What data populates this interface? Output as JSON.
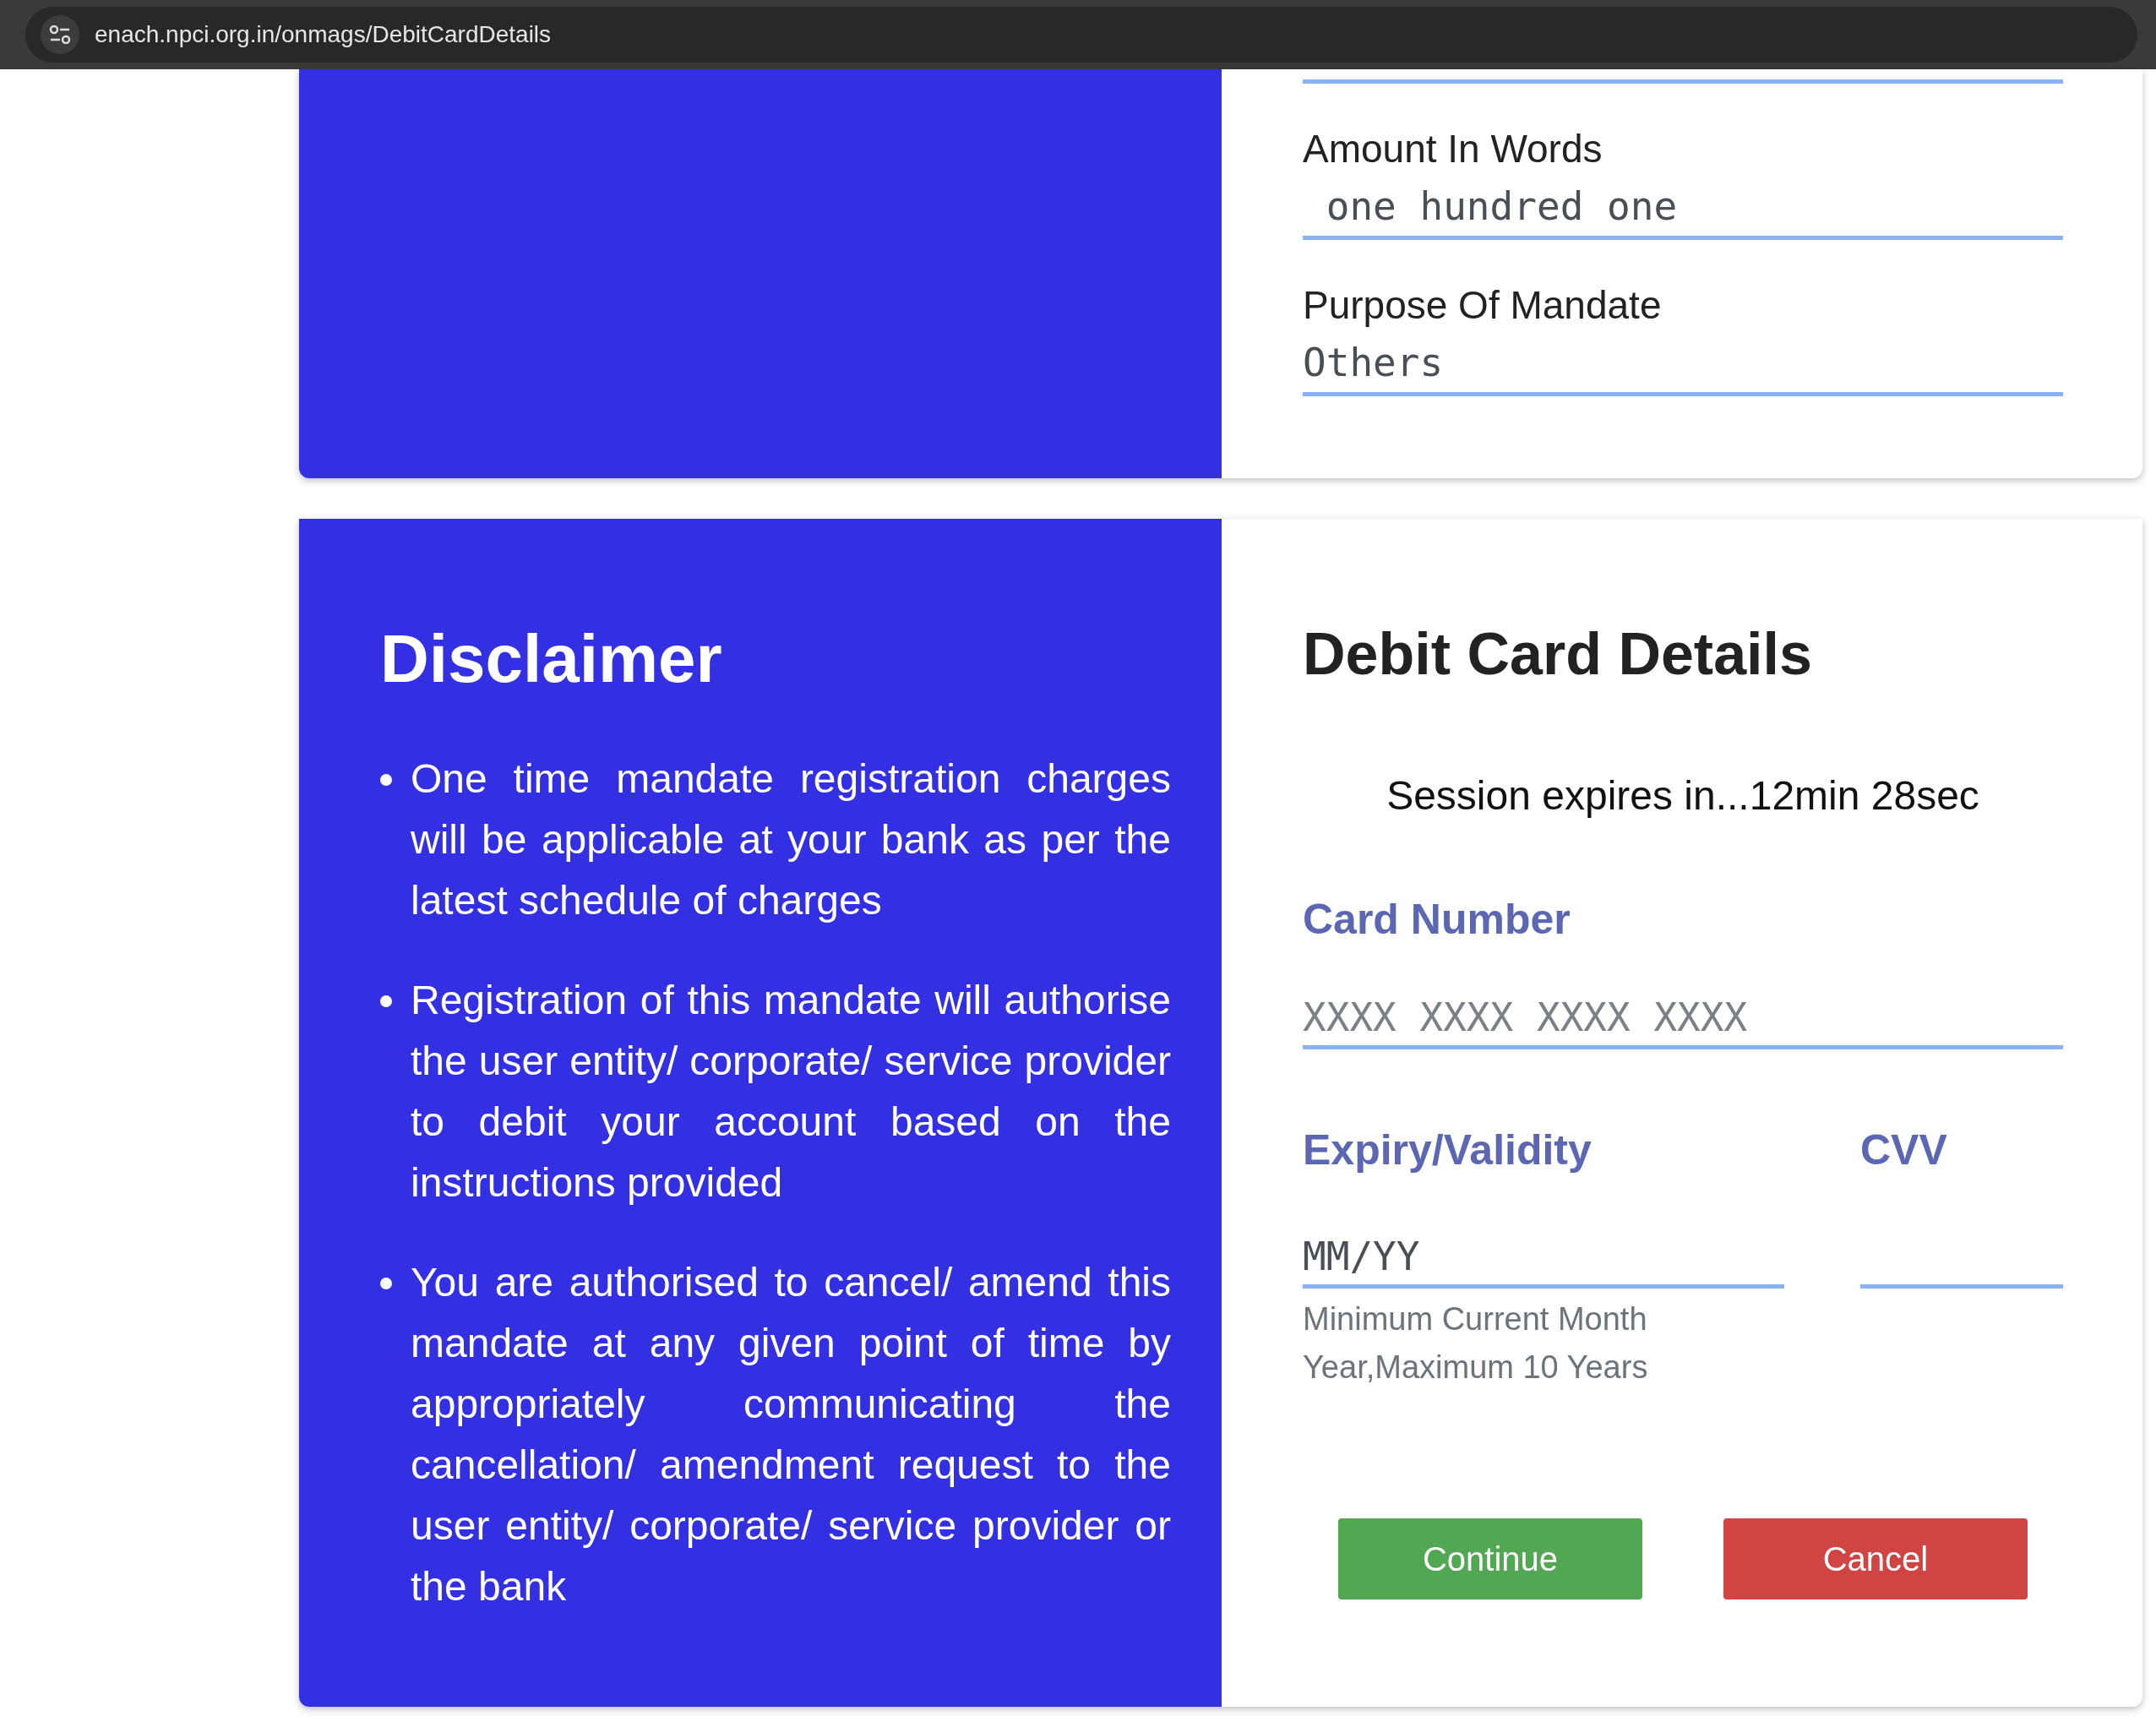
{
  "browser": {
    "url": "enach.npci.org.in/onmags/DebitCardDetails"
  },
  "mandate_card": {
    "fields": [
      {
        "label": "Amount In Words",
        "value": " one hundred one"
      },
      {
        "label": "Purpose Of Mandate",
        "value": "Others"
      }
    ]
  },
  "disclaimer": {
    "title": "Disclaimer",
    "items": [
      "One time mandate registration charges will be applicable at your bank as per the latest schedule of charges",
      "Registration of this mandate will authorise the user entity/ corporate/ service provider to debit your account based on the instructions provided",
      "You are authorised to cancel/ amend this mandate at any given point of time by appropriately communicating the cancellation/ amendment request to the user entity/ corporate/ service provider or the bank"
    ]
  },
  "debit_card": {
    "title": "Debit Card Details",
    "session": "Session expires in...12min 28sec",
    "card_number": {
      "label": "Card Number",
      "placeholder": "XXXX XXXX XXXX XXXX"
    },
    "expiry": {
      "label": "Expiry/Validity",
      "placeholder": "MM/YY",
      "hint": "Minimum Current Month Year,Maximum 10 Years"
    },
    "cvv": {
      "label": "CVV"
    },
    "buttons": [
      {
        "label": "Continue",
        "kind": "primary"
      },
      {
        "label": "Cancel",
        "kind": "danger"
      }
    ]
  }
}
